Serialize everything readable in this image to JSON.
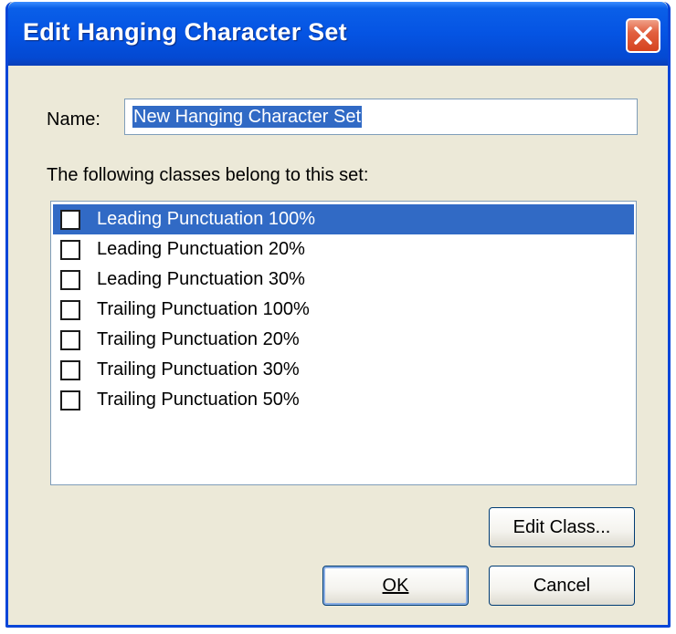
{
  "dialog": {
    "title": "Edit Hanging Character Set"
  },
  "name_field": {
    "label": "Name:",
    "value": "New Hanging Character Set"
  },
  "classes": {
    "label": "The following classes belong to this set:",
    "items": [
      {
        "label": "Leading Punctuation 100%",
        "checked": false,
        "selected": true
      },
      {
        "label": "Leading Punctuation 20%",
        "checked": false,
        "selected": false
      },
      {
        "label": "Leading Punctuation 30%",
        "checked": false,
        "selected": false
      },
      {
        "label": "Trailing Punctuation 100%",
        "checked": false,
        "selected": false
      },
      {
        "label": "Trailing Punctuation 20%",
        "checked": false,
        "selected": false
      },
      {
        "label": "Trailing Punctuation 30%",
        "checked": false,
        "selected": false
      },
      {
        "label": "Trailing Punctuation 50%",
        "checked": false,
        "selected": false
      }
    ]
  },
  "buttons": {
    "edit_class": "Edit Class...",
    "ok": "OK",
    "cancel": "Cancel"
  },
  "colors": {
    "titlebar": "#0554e3",
    "selection": "#316ac5",
    "close": "#d5431f",
    "dialog_bg": "#ece9d8"
  },
  "icons": {
    "close": "close-icon"
  }
}
